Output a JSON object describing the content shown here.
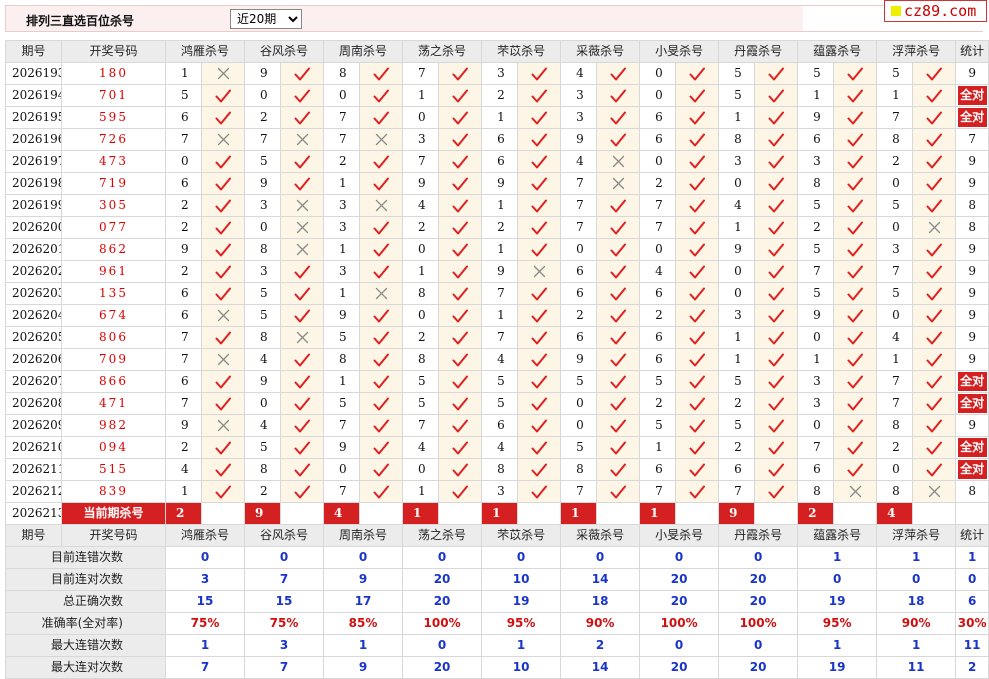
{
  "header": {
    "title": "排列三直选百位杀号",
    "period_selected": "近20期",
    "period_options": [
      "近20期"
    ]
  },
  "logo": {
    "text": "cz89.com"
  },
  "columns": {
    "issue": "期号",
    "winning": "开奖号码",
    "experts": [
      "鸿雁杀号",
      "谷风杀号",
      "周南杀号",
      "荡之杀号",
      "芣苡杀号",
      "采薇杀号",
      "小旻杀号",
      "丹霞杀号",
      "蕴露杀号",
      "浮萍杀号"
    ],
    "stat": "统计"
  },
  "full_correct_label": "全对",
  "rows": [
    {
      "issue": "2026193",
      "win": "180",
      "picks": [
        "1",
        "9",
        "8",
        "7",
        "3",
        "4",
        "0",
        "5",
        "5",
        "5"
      ],
      "ok": [
        0,
        1,
        1,
        1,
        1,
        1,
        1,
        1,
        1,
        1
      ],
      "stat": "9",
      "full": false
    },
    {
      "issue": "2026194",
      "win": "701",
      "picks": [
        "5",
        "0",
        "0",
        "1",
        "2",
        "3",
        "0",
        "5",
        "1",
        "1"
      ],
      "ok": [
        1,
        1,
        1,
        1,
        1,
        1,
        1,
        1,
        1,
        1
      ],
      "stat": "",
      "full": true
    },
    {
      "issue": "2026195",
      "win": "595",
      "picks": [
        "6",
        "2",
        "7",
        "0",
        "1",
        "3",
        "6",
        "1",
        "9",
        "7"
      ],
      "ok": [
        1,
        1,
        1,
        1,
        1,
        1,
        1,
        1,
        1,
        1
      ],
      "stat": "",
      "full": true
    },
    {
      "issue": "2026196",
      "win": "726",
      "picks": [
        "7",
        "7",
        "7",
        "3",
        "6",
        "9",
        "6",
        "8",
        "6",
        "8"
      ],
      "ok": [
        0,
        0,
        0,
        1,
        1,
        1,
        1,
        1,
        1,
        1
      ],
      "stat": "7",
      "full": false
    },
    {
      "issue": "2026197",
      "win": "473",
      "picks": [
        "0",
        "5",
        "2",
        "7",
        "6",
        "4",
        "0",
        "3",
        "3",
        "2"
      ],
      "ok": [
        1,
        1,
        1,
        1,
        1,
        0,
        1,
        1,
        1,
        1
      ],
      "stat": "9",
      "full": false
    },
    {
      "issue": "2026198",
      "win": "719",
      "picks": [
        "6",
        "9",
        "1",
        "9",
        "9",
        "7",
        "2",
        "0",
        "8",
        "0"
      ],
      "ok": [
        1,
        1,
        1,
        1,
        1,
        0,
        1,
        1,
        1,
        1
      ],
      "stat": "9",
      "full": false
    },
    {
      "issue": "2026199",
      "win": "305",
      "picks": [
        "2",
        "3",
        "3",
        "4",
        "1",
        "7",
        "7",
        "4",
        "5",
        "5"
      ],
      "ok": [
        1,
        0,
        0,
        1,
        1,
        1,
        1,
        1,
        1,
        1
      ],
      "stat": "8",
      "full": false
    },
    {
      "issue": "2026200",
      "win": "077",
      "picks": [
        "2",
        "0",
        "3",
        "2",
        "2",
        "7",
        "7",
        "1",
        "2",
        "0"
      ],
      "ok": [
        1,
        0,
        1,
        1,
        1,
        1,
        1,
        1,
        1,
        0
      ],
      "stat": "8",
      "full": false
    },
    {
      "issue": "2026201",
      "win": "862",
      "picks": [
        "9",
        "8",
        "1",
        "0",
        "1",
        "0",
        "0",
        "9",
        "5",
        "3"
      ],
      "ok": [
        1,
        0,
        1,
        1,
        1,
        1,
        1,
        1,
        1,
        1
      ],
      "stat": "9",
      "full": false
    },
    {
      "issue": "2026202",
      "win": "961",
      "picks": [
        "2",
        "3",
        "3",
        "1",
        "9",
        "6",
        "4",
        "0",
        "7",
        "7"
      ],
      "ok": [
        1,
        1,
        1,
        1,
        0,
        1,
        1,
        1,
        1,
        1
      ],
      "stat": "9",
      "full": false
    },
    {
      "issue": "2026203",
      "win": "135",
      "picks": [
        "6",
        "5",
        "1",
        "8",
        "7",
        "6",
        "6",
        "0",
        "5",
        "5"
      ],
      "ok": [
        1,
        1,
        0,
        1,
        1,
        1,
        1,
        1,
        1,
        1
      ],
      "stat": "9",
      "full": false
    },
    {
      "issue": "2026204",
      "win": "674",
      "picks": [
        "6",
        "5",
        "9",
        "0",
        "1",
        "2",
        "2",
        "3",
        "9",
        "0"
      ],
      "ok": [
        0,
        1,
        1,
        1,
        1,
        1,
        1,
        1,
        1,
        1
      ],
      "stat": "9",
      "full": false
    },
    {
      "issue": "2026205",
      "win": "806",
      "picks": [
        "7",
        "8",
        "5",
        "2",
        "7",
        "6",
        "6",
        "1",
        "0",
        "4"
      ],
      "ok": [
        1,
        0,
        1,
        1,
        1,
        1,
        1,
        1,
        1,
        1
      ],
      "stat": "9",
      "full": false
    },
    {
      "issue": "2026206",
      "win": "709",
      "picks": [
        "7",
        "4",
        "8",
        "8",
        "4",
        "9",
        "6",
        "1",
        "1",
        "1"
      ],
      "ok": [
        0,
        1,
        1,
        1,
        1,
        1,
        1,
        1,
        1,
        1
      ],
      "stat": "9",
      "full": false
    },
    {
      "issue": "2026207",
      "win": "866",
      "picks": [
        "6",
        "9",
        "1",
        "5",
        "5",
        "5",
        "5",
        "5",
        "3",
        "7"
      ],
      "ok": [
        1,
        1,
        1,
        1,
        1,
        1,
        1,
        1,
        1,
        1
      ],
      "stat": "",
      "full": true
    },
    {
      "issue": "2026208",
      "win": "471",
      "picks": [
        "7",
        "0",
        "5",
        "5",
        "5",
        "0",
        "2",
        "2",
        "3",
        "7"
      ],
      "ok": [
        1,
        1,
        1,
        1,
        1,
        1,
        1,
        1,
        1,
        1
      ],
      "stat": "",
      "full": true
    },
    {
      "issue": "2026209",
      "win": "982",
      "picks": [
        "9",
        "4",
        "7",
        "7",
        "6",
        "0",
        "5",
        "5",
        "0",
        "8"
      ],
      "ok": [
        0,
        1,
        1,
        1,
        1,
        1,
        1,
        1,
        1,
        1
      ],
      "stat": "9",
      "full": false
    },
    {
      "issue": "2026210",
      "win": "094",
      "picks": [
        "2",
        "5",
        "9",
        "4",
        "4",
        "5",
        "1",
        "2",
        "7",
        "2"
      ],
      "ok": [
        1,
        1,
        1,
        1,
        1,
        1,
        1,
        1,
        1,
        1
      ],
      "stat": "",
      "full": true
    },
    {
      "issue": "2026211",
      "win": "515",
      "picks": [
        "4",
        "8",
        "0",
        "0",
        "8",
        "8",
        "6",
        "6",
        "6",
        "0"
      ],
      "ok": [
        1,
        1,
        1,
        1,
        1,
        1,
        1,
        1,
        1,
        1
      ],
      "stat": "",
      "full": true
    },
    {
      "issue": "2026212",
      "win": "839",
      "picks": [
        "1",
        "2",
        "7",
        "1",
        "3",
        "7",
        "7",
        "7",
        "8",
        "8"
      ],
      "ok": [
        1,
        1,
        1,
        1,
        1,
        1,
        1,
        1,
        0,
        0
      ],
      "stat": "8",
      "full": false
    }
  ],
  "current": {
    "issue": "2026213",
    "label": "当前期杀号",
    "picks": [
      "2",
      "9",
      "4",
      "1",
      "1",
      "1",
      "1",
      "9",
      "2",
      "4"
    ]
  },
  "stats": [
    {
      "label": "目前连错次数",
      "values": [
        "0",
        "0",
        "0",
        "0",
        "0",
        "0",
        "0",
        "0",
        "1",
        "1",
        "1"
      ]
    },
    {
      "label": "目前连对次数",
      "values": [
        "3",
        "7",
        "9",
        "20",
        "10",
        "14",
        "20",
        "20",
        "0",
        "0",
        "0"
      ]
    },
    {
      "label": "总正确次数",
      "values": [
        "15",
        "15",
        "17",
        "20",
        "19",
        "18",
        "20",
        "20",
        "19",
        "18",
        "6"
      ]
    },
    {
      "label": "准确率(全对率)",
      "values": [
        "75%",
        "75%",
        "85%",
        "100%",
        "95%",
        "90%",
        "100%",
        "100%",
        "95%",
        "90%",
        "30%"
      ],
      "red": true
    },
    {
      "label": "最大连错次数",
      "values": [
        "1",
        "3",
        "1",
        "0",
        "1",
        "2",
        "0",
        "0",
        "1",
        "1",
        "11"
      ]
    },
    {
      "label": "最大连对次数",
      "values": [
        "7",
        "7",
        "9",
        "20",
        "10",
        "14",
        "20",
        "20",
        "19",
        "11",
        "2"
      ]
    }
  ],
  "colors": {
    "accent_red": "#d42020",
    "check_red": "#e02020",
    "cross_gray": "#8a8a8a",
    "stat_blue": "#1a35c8",
    "mark_bg": "#fdf5e6",
    "header_bg": "#ececec"
  }
}
